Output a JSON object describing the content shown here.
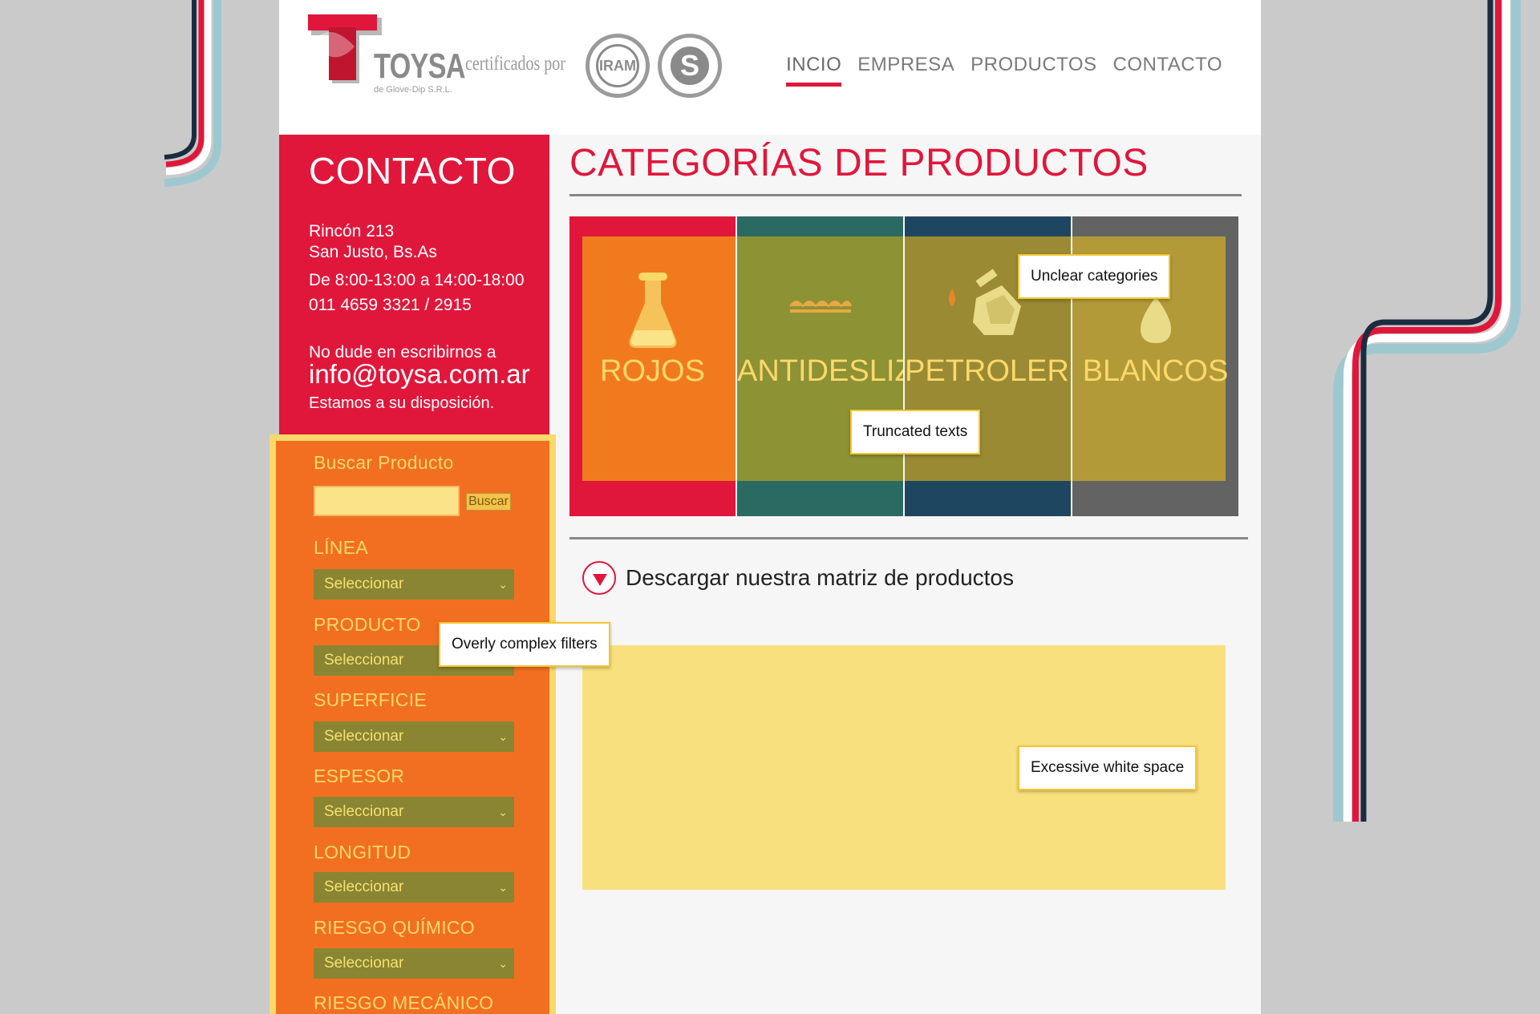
{
  "brand": {
    "name": "TOYSA",
    "subtitle": "de Glove-Dip S.R.L.",
    "certified_text": "certificados por",
    "seal1_text": "IRAM",
    "seal2_text": "S"
  },
  "nav": {
    "items": [
      "INCIO",
      "EMPRESA",
      "PRODUCTOS",
      "CONTACTO"
    ],
    "active": "INCIO"
  },
  "contact": {
    "title": "CONTACTO",
    "address_line1": "Rincón 213",
    "address_line2": "San Justo, Bs.As",
    "hours": "De 8:00-13:00 a 14:00-18:00",
    "phone": "011 4659 3321 / 2915",
    "write_prompt": "No dude en escribirnos a",
    "email": "info@toysa.com.ar",
    "availability": "Estamos a su disposición."
  },
  "filters": {
    "search_label": "Buscar Producto",
    "search_value": "",
    "search_button": "Buscar",
    "select_placeholder": "Seleccionar",
    "fields": [
      "LÍNEA",
      "PRODUCTO",
      "SUPERFICIE",
      "ESPESOR",
      "LONGITUD",
      "RIESGO QUÍMICO",
      "RIESGO MECÁNICO"
    ]
  },
  "main": {
    "title": "CATEGORÍAS DE PRODUCTOS",
    "categories": [
      {
        "label": "ROJOS",
        "icon": "flask-icon",
        "color": "#e0173b"
      },
      {
        "label": "ANTIDESLIZ",
        "icon": "grip-texture-icon",
        "color": "#2a6a63"
      },
      {
        "label": "PETROLER",
        "icon": "oil-can-icon",
        "color": "#1e4660"
      },
      {
        "label": "BLANCOS",
        "icon": "drop-icon",
        "color": "#636363"
      }
    ],
    "download_text": "Descargar nuestra matriz de productos"
  },
  "annotations": {
    "unclear_categories": "Unclear categories",
    "truncated_texts": "Truncated texts",
    "complex_filters": "Overly complex filters",
    "white_space": "Excessive white space"
  },
  "colors": {
    "brand_red": "#e0173b",
    "sidebar_orange": "#f26f21",
    "highlight_yellow": "#fbd86a",
    "select_olive": "#8a8532"
  }
}
